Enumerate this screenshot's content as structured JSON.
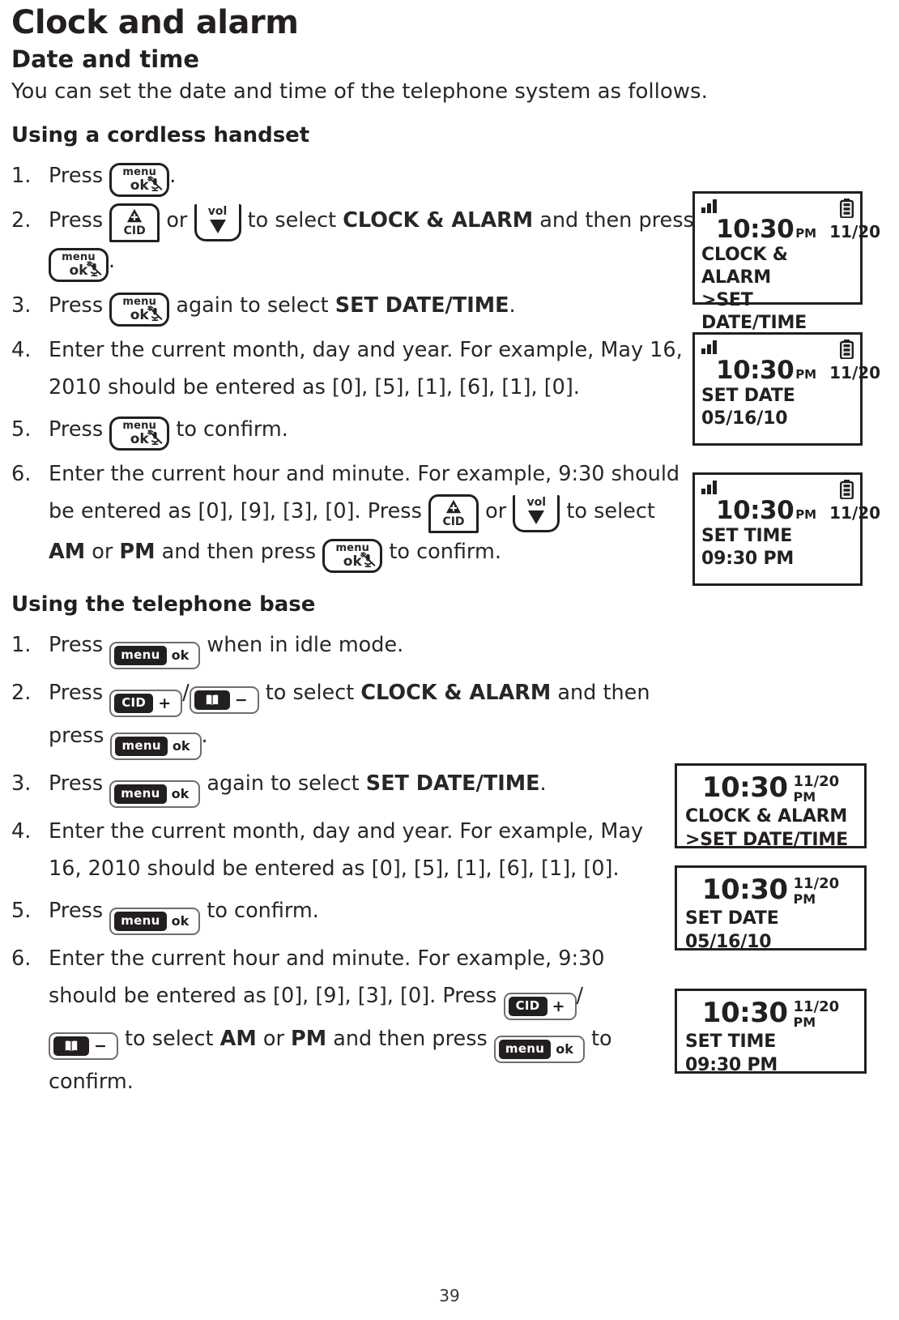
{
  "title": "Clock and alarm",
  "subtitle": "Date and time",
  "intro": "You can set the date and time of the telephone system as follows.",
  "handset": {
    "heading": "Using a cordless handset",
    "steps": [
      {
        "num": "1.",
        "parts": [
          "Press ",
          "[KEY:menuok]",
          "."
        ]
      },
      {
        "num": "2.",
        "parts": [
          "Press ",
          "[KEY:cid]",
          " or ",
          "[KEY:vol]",
          " to select ",
          "[B]CLOCK & ALARM",
          " and then press ",
          "[KEY:menuok]",
          "."
        ]
      },
      {
        "num": "3.",
        "parts": [
          "Press ",
          "[KEY:menuok]",
          " again to select ",
          "[B]SET DATE/TIME",
          "."
        ]
      },
      {
        "num": "4.",
        "parts": [
          "Enter the current month, day and year. For example, May 16, 2010 should be entered as [0], [5], [1], [6], [1], [0]."
        ]
      },
      {
        "num": "5.",
        "parts": [
          "Press ",
          "[KEY:menuok]",
          " to confirm."
        ]
      },
      {
        "num": "6.",
        "parts": [
          "Enter the current hour and minute. For example, 9:30 should be entered as [0], [9], [3], [0]. Press ",
          "[KEY:cid]",
          " or ",
          "[KEY:vol]",
          " to select ",
          "[B]AM",
          " or ",
          "[B]PM",
          " and then press ",
          "[KEY:menuok]",
          " to confirm."
        ]
      }
    ]
  },
  "base": {
    "heading": "Using the telephone base",
    "steps": [
      {
        "num": "1.",
        "parts": [
          "Press ",
          "[KEY:bmenuok]",
          " when in idle mode."
        ]
      },
      {
        "num": "2.",
        "parts": [
          "Press ",
          "[KEY:bcidplus]",
          "/",
          "[KEY:bbookminus]",
          " to select ",
          "[B]CLOCK & ALARM",
          " and then press ",
          "[KEY:bmenuok]",
          "."
        ]
      },
      {
        "num": "3.",
        "parts": [
          "Press ",
          "[KEY:bmenuok]",
          " again to select ",
          "[B]SET DATE/TIME",
          "."
        ]
      },
      {
        "num": "4.",
        "parts": [
          "Enter the current month, day and year. For example, May 16, 2010 should be entered as [0], [5], [1], [6], [1], [0]."
        ]
      },
      {
        "num": "5.",
        "parts": [
          "Press ",
          "[KEY:bmenuok]",
          " to confirm."
        ]
      },
      {
        "num": "6.",
        "parts": [
          "Enter the current hour and minute. For example, 9:30 should be entered as [0], [9], [3], [0]. Press ",
          "[KEY:bcidplus]",
          "/",
          "[KEY:bbookminus]",
          " to select ",
          "[B]AM",
          " or ",
          "[B]PM",
          " and then press ",
          "[KEY:bmenuok]",
          " to confirm."
        ]
      }
    ]
  },
  "keys": {
    "menuok": {
      "line1": "menu",
      "line2": "ok",
      "icon": "mute-icon"
    },
    "cid": {
      "label": "CID",
      "icon": "up-arrow-icon"
    },
    "vol": {
      "label": "vol",
      "icon": "down-arrow-icon"
    },
    "bmenuok": {
      "pill": "menu",
      "side": "ok"
    },
    "bcidplus": {
      "pill": "CID",
      "side": "+"
    },
    "bbookminus": {
      "pill_icon": "phonebook-icon",
      "side": "−"
    }
  },
  "handset_screens": [
    {
      "signal": "signal-bars-icon",
      "battery": "battery-icon",
      "time": "10:30",
      "ampm": "PM",
      "date": "11/20",
      "line1": "CLOCK & ALARM",
      "line2": ">SET DATE/TIME"
    },
    {
      "signal": "signal-bars-icon",
      "battery": "battery-icon",
      "time": "10:30",
      "ampm": "PM",
      "date": "11/20",
      "line1": "SET DATE",
      "line2": "05/16/10"
    },
    {
      "signal": "signal-bars-icon",
      "battery": "battery-icon",
      "time": "10:30",
      "ampm": "PM",
      "date": "11/20",
      "line1": "SET TIME",
      "line2": "09:30 PM"
    }
  ],
  "base_screens": [
    {
      "time": "10:30",
      "date": "11/20",
      "ampm": "PM",
      "line1": "CLOCK & ALARM",
      "line2": ">SET DATE/TIME"
    },
    {
      "time": "10:30",
      "date": "11/20",
      "ampm": "PM",
      "line1": "SET DATE",
      "line2": "05/16/10"
    },
    {
      "time": "10:30",
      "date": "11/20",
      "ampm": "PM",
      "line1": "SET TIME",
      "line2": "09:30 PM"
    }
  ],
  "page_number": "39",
  "colors": {
    "ink": "#231f20",
    "key_outline": "#6d6e71"
  }
}
